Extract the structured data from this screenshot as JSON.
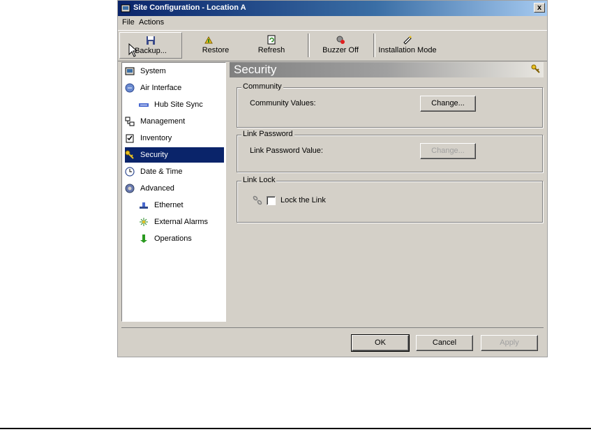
{
  "window": {
    "title": "Site Configuration - Location A",
    "close_label": "x"
  },
  "menu": [
    "File",
    "Actions"
  ],
  "toolbar": [
    {
      "label": "Backup...",
      "icon": "floppy-disk-icon"
    },
    {
      "label": "Restore",
      "icon": "restore-arrow-icon"
    },
    {
      "label": "Refresh",
      "icon": "refresh-document-icon"
    },
    {
      "label": "Buzzer Off",
      "icon": "buzzer-off-icon"
    },
    {
      "label": "Installation Mode",
      "icon": "installation-mode-icon"
    }
  ],
  "tree": [
    {
      "label": "System",
      "icon": "system-icon",
      "indent": false,
      "selected": false
    },
    {
      "label": "Air Interface",
      "icon": "air-interface-icon",
      "indent": false,
      "selected": false
    },
    {
      "label": "Hub Site Sync",
      "icon": "hub-sync-icon",
      "indent": true,
      "selected": false
    },
    {
      "label": "Management",
      "icon": "management-icon",
      "indent": false,
      "selected": false
    },
    {
      "label": "Inventory",
      "icon": "inventory-icon",
      "indent": false,
      "selected": false
    },
    {
      "label": "Security",
      "icon": "security-keys-icon",
      "indent": false,
      "selected": true
    },
    {
      "label": "Date & Time",
      "icon": "clock-icon",
      "indent": false,
      "selected": false
    },
    {
      "label": "Advanced",
      "icon": "advanced-gear-icon",
      "indent": false,
      "selected": false
    },
    {
      "label": "Ethernet",
      "icon": "ethernet-icon",
      "indent": true,
      "selected": false
    },
    {
      "label": "External Alarms",
      "icon": "alarm-icon",
      "indent": true,
      "selected": false
    },
    {
      "label": "Operations",
      "icon": "operations-arrow-icon",
      "indent": true,
      "selected": false
    }
  ],
  "panel": {
    "title": "Security",
    "community": {
      "group_title": "Community",
      "label": "Community Values:",
      "button": "Change..."
    },
    "link_password": {
      "group_title": "Link Password",
      "label": "Link Password Value:",
      "button": "Change..."
    },
    "link_lock": {
      "group_title": "Link Lock",
      "checkbox_label": "Lock the Link",
      "checked": false
    }
  },
  "footer": {
    "ok": "OK",
    "cancel": "Cancel",
    "apply": "Apply"
  }
}
